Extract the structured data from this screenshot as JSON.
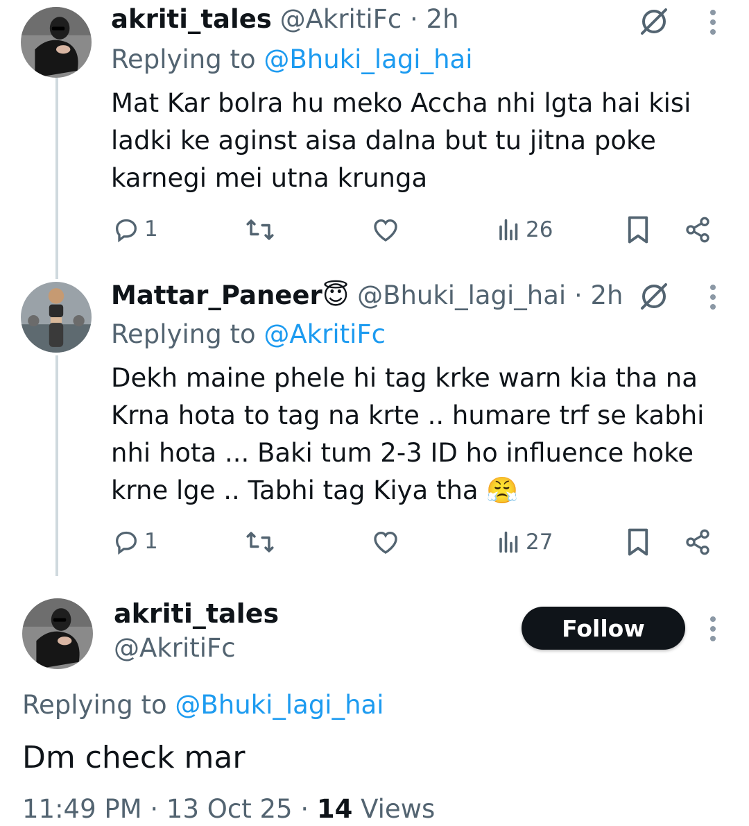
{
  "tweets": [
    {
      "name": "akriti_tales",
      "handle": "@AkritiFc",
      "dot": "·",
      "time": "2h",
      "replying_label": "Replying to",
      "replying_to": "@Bhuki_lagi_hai",
      "text": "Mat Kar bolra hu meko Accha nhi lgta hai kisi ladki ke aginst aisa dalna but tu jitna poke karnegi mei utna krunga",
      "replies": "1",
      "views": "26"
    },
    {
      "name": "Mattar_Paneer",
      "name_emoji": "😇",
      "handle": "@Bhuki_lagi_hai",
      "dot": "·",
      "time": "2h",
      "replying_label": "Replying to",
      "replying_to": "@AkritiFc",
      "text": "Dekh maine phele hi tag krke warn kia tha na Krna hota to tag na krte .. humare trf se kabhi nhi hota ... Baki tum 2-3 ID ho influence hoke krne lge .. Tabhi tag Kiya tha",
      "text_emoji": "😤",
      "replies": "1",
      "views": "27"
    }
  ],
  "main_tweet": {
    "name": "akriti_tales",
    "handle": "@AkritiFc",
    "follow_label": "Follow",
    "replying_label": "Replying to",
    "replying_to": "@Bhuki_lagi_hai",
    "text": "Dm check mar",
    "time": "11:49 PM",
    "date": "13 Oct 25",
    "sep": "·",
    "views_count": "14",
    "views_label": "Views"
  },
  "colors": {
    "text": "#0f1419",
    "secondary": "#536471",
    "accent": "#1d9bf0",
    "thread_line": "#cfd9de",
    "follow_bg": "#0f1419"
  },
  "icons": [
    "grok-icon",
    "more-icon",
    "reply-icon",
    "retweet-icon",
    "like-icon",
    "views-icon",
    "bookmark-icon",
    "share-icon"
  ]
}
